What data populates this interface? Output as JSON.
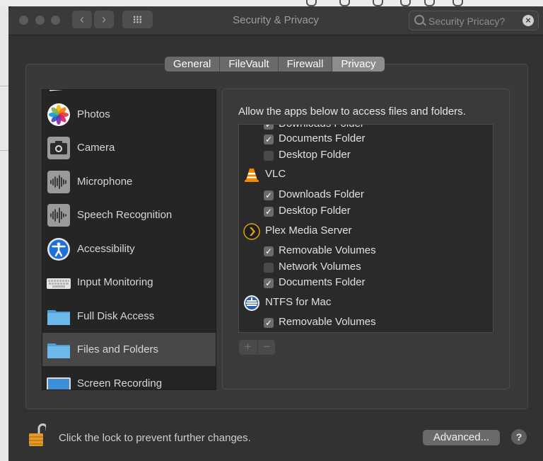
{
  "window": {
    "title": "Security & Privacy"
  },
  "search": {
    "value": "Security Pricacy?"
  },
  "tabs": [
    {
      "label": "General"
    },
    {
      "label": "FileVault"
    },
    {
      "label": "Firewall"
    },
    {
      "label": "Privacy"
    }
  ],
  "sidebar": {
    "items": [
      {
        "label": "Photos",
        "icon": "photos-icon"
      },
      {
        "label": "Camera",
        "icon": "camera-icon"
      },
      {
        "label": "Microphone",
        "icon": "microphone-icon"
      },
      {
        "label": "Speech Recognition",
        "icon": "speech-recognition-icon"
      },
      {
        "label": "Accessibility",
        "icon": "accessibility-icon"
      },
      {
        "label": "Input Monitoring",
        "icon": "keyboard-icon"
      },
      {
        "label": "Full Disk Access",
        "icon": "folder-icon"
      },
      {
        "label": "Files and Folders",
        "icon": "folder-icon",
        "selected": true
      },
      {
        "label": "Screen Recording",
        "icon": "screen-icon"
      }
    ]
  },
  "detail": {
    "description": "Allow the apps below to access files and folders.",
    "rows": [
      {
        "type": "item",
        "label": "Downloads Folder",
        "checked": true
      },
      {
        "type": "item",
        "label": "Documents Folder",
        "checked": true
      },
      {
        "type": "item",
        "label": "Desktop Folder",
        "checked": false
      },
      {
        "type": "app",
        "label": "VLC",
        "icon": "vlc-icon"
      },
      {
        "type": "item",
        "label": "Downloads Folder",
        "checked": true
      },
      {
        "type": "item",
        "label": "Desktop Folder",
        "checked": true
      },
      {
        "type": "app",
        "label": "Plex Media Server",
        "icon": "plex-icon"
      },
      {
        "type": "item",
        "label": "Removable Volumes",
        "checked": true
      },
      {
        "type": "item",
        "label": "Network Volumes",
        "checked": false
      },
      {
        "type": "item",
        "label": "Documents Folder",
        "checked": true
      },
      {
        "type": "app",
        "label": "NTFS for Mac",
        "icon": "ntfs-icon"
      },
      {
        "type": "item",
        "label": "Removable Volumes",
        "checked": true
      }
    ],
    "add_label": "+",
    "remove_label": "−"
  },
  "footer": {
    "lock_message": "Click the lock to prevent further changes.",
    "advanced_label": "Advanced...",
    "help_label": "?"
  }
}
